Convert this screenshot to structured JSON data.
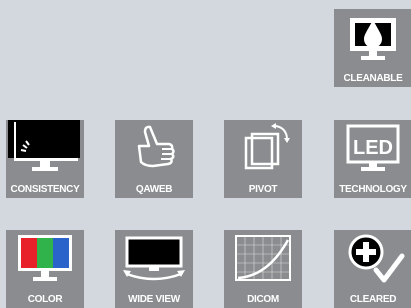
{
  "icons": {
    "cleanable": {
      "label": "CLEANABLE",
      "icon": "water-drop-monitor-icon"
    },
    "consistency": {
      "label": "CONSISTENCY",
      "icon": "monitor-calibration-icon"
    },
    "qaweb": {
      "label": "QAWEB",
      "icon": "thumbs-up-icon"
    },
    "pivot": {
      "label": "PIVOT",
      "icon": "rotate-screen-icon"
    },
    "led": {
      "label": "TECHNOLOGY",
      "icon_text": "LED",
      "icon": "led-monitor-icon"
    },
    "color": {
      "label": "COLOR",
      "icon": "rgb-monitor-icon"
    },
    "wideview": {
      "label": "WIDE VIEW",
      "icon": "wide-angle-monitor-icon"
    },
    "dicom": {
      "label": "DICOM",
      "icon": "dicom-curve-icon"
    },
    "cleared": {
      "label": "CLEARED",
      "icon": "medical-cross-check-icon"
    }
  },
  "colors": {
    "background": "#d3d8de",
    "tile": "#8a8c8f",
    "icon": "#ffffff",
    "screen": "#000000",
    "rgb_red": "#e8202a",
    "rgb_green": "#2fb34a",
    "rgb_blue": "#2a63c9"
  }
}
